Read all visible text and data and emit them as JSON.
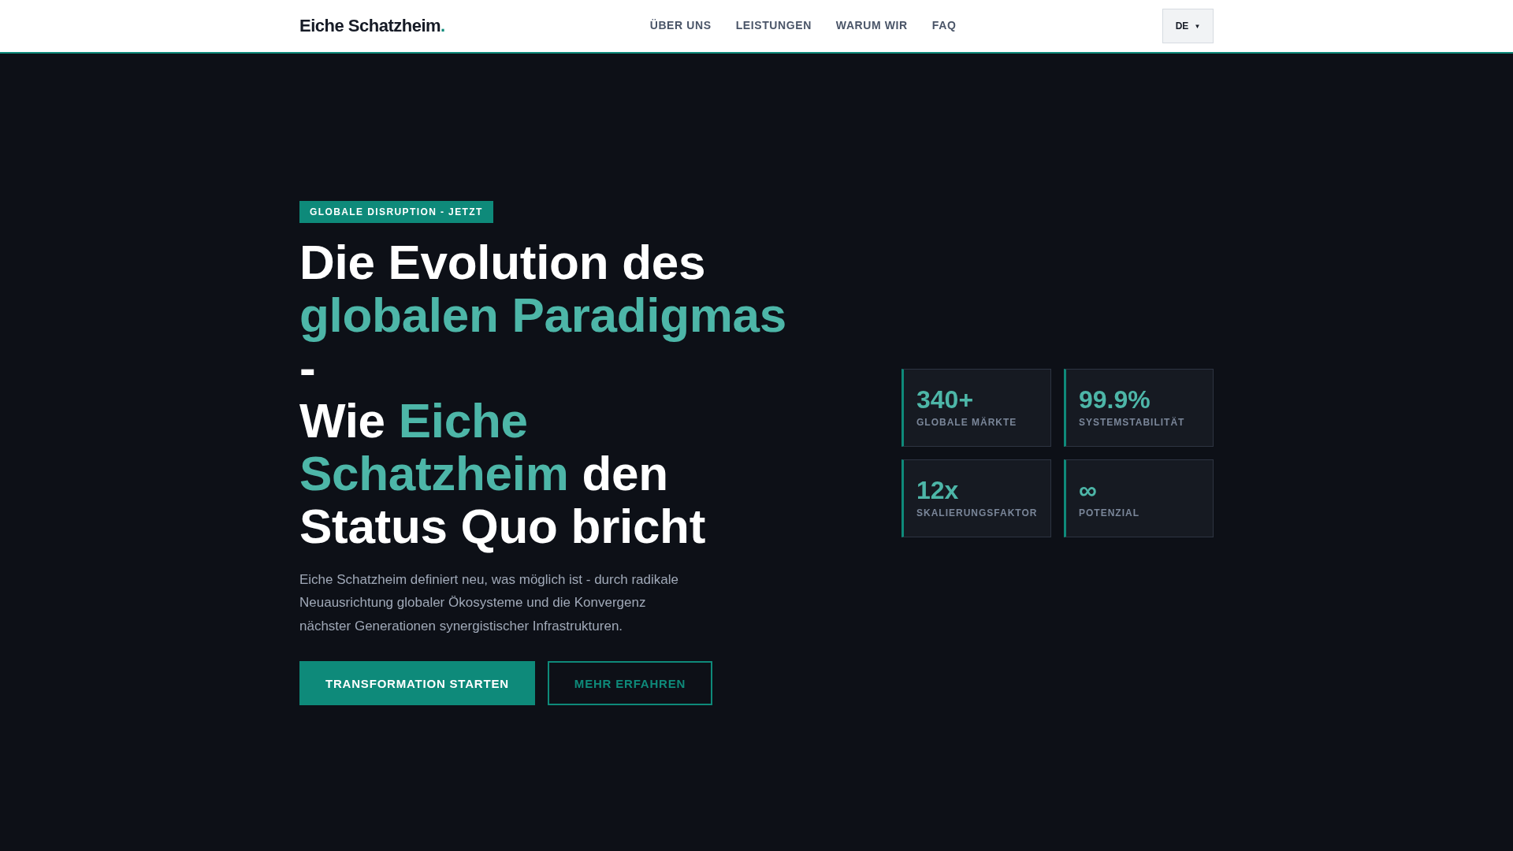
{
  "header": {
    "logo": {
      "text": "Eiche Schatzheim",
      "dot": "."
    },
    "nav": [
      {
        "label": "ÜBER UNS"
      },
      {
        "label": "LEISTUNGEN"
      },
      {
        "label": "WARUM WIR"
      },
      {
        "label": "FAQ"
      }
    ],
    "language": {
      "label": "DE",
      "caret": "▼"
    }
  },
  "hero": {
    "badge": "GLOBALE DISRUPTION - JETZT",
    "headline": [
      [
        {
          "text": "Die Evolution des ",
          "accent": false
        },
        {
          "text": "globalen Paradigmas",
          "accent": true
        },
        {
          "text": " -",
          "accent": false
        }
      ],
      [
        {
          "text": "Wie ",
          "accent": false
        },
        {
          "text": "Eiche Schatzheim",
          "accent": true
        },
        {
          "text": " den Status Quo bricht",
          "accent": false
        }
      ]
    ],
    "description": "Eiche Schatzheim definiert neu, was möglich ist - durch radikale Neuausrichtung globaler Ökosysteme und die Konvergenz nächster Generationen synergistischer Infrastrukturen.",
    "buttons": [
      {
        "label": "TRANSFORMATION STARTEN",
        "kind": "primary"
      },
      {
        "label": "MEHR ERFAHREN",
        "kind": "outline"
      }
    ],
    "stats": [
      {
        "value": "340+",
        "label": "GLOBALE MÄRKTE"
      },
      {
        "value": "99.9%",
        "label": "SYSTEMSTABILITÄT"
      },
      {
        "value": "12x",
        "label": "SKALIERUNGSFAKTOR"
      },
      {
        "value": "∞",
        "label": "POTENZIAL"
      }
    ]
  }
}
